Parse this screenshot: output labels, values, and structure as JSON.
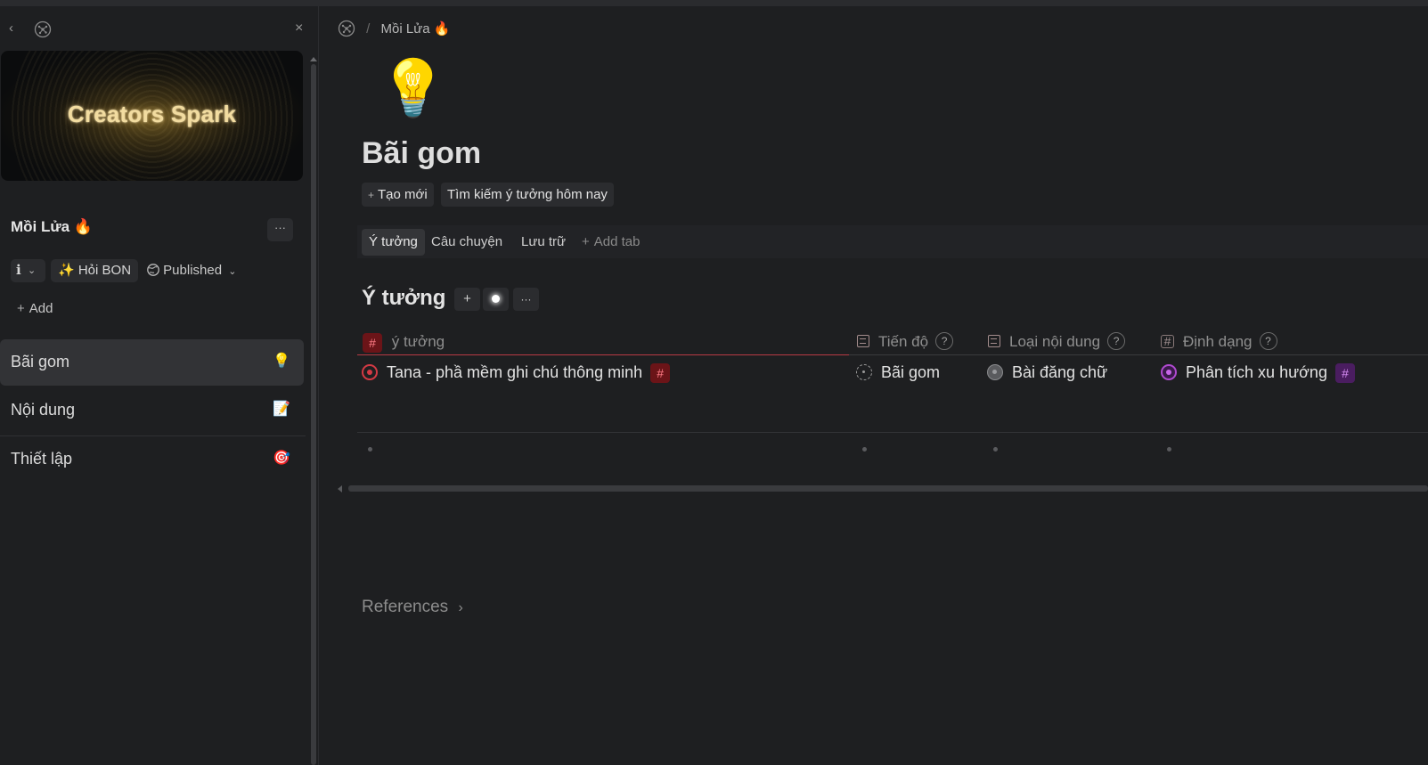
{
  "sidebar": {
    "banner_title": "Creators Spark",
    "workspace_name": "Mồi Lửa 🔥",
    "more_label": "···",
    "info_label": "ℹ",
    "ask_label": "✨ Hỏi BON",
    "publish_label": "Published",
    "add_label": "Add",
    "items": [
      {
        "label": "Bãi gom",
        "emoji": "💡",
        "active": true
      },
      {
        "label": "Nội dung",
        "emoji": "📝",
        "active": false
      },
      {
        "label": "Thiết lập",
        "emoji": "🎯",
        "active": false
      }
    ]
  },
  "breadcrumb": {
    "page": "Mồi Lửa 🔥"
  },
  "page": {
    "emoji": "💡",
    "title": "Bãi gom",
    "actions": {
      "create": "Tạo mới",
      "search": "Tìm kiếm ý tưởng hôm nay"
    },
    "tabs": [
      {
        "label": "Ý tưởng",
        "active": true
      },
      {
        "label": "Câu chuyện",
        "active": false
      },
      {
        "label": "Lưu trữ",
        "active": false
      }
    ],
    "add_tab_label": "Add tab",
    "section": {
      "title": "Ý tưởng",
      "add_btn": "+",
      "more_btn": "···"
    },
    "table": {
      "columns": [
        {
          "label": "ý tưởng",
          "type": "tag"
        },
        {
          "label": "Tiến độ",
          "type": "list"
        },
        {
          "label": "Loại nội dung",
          "type": "list"
        },
        {
          "label": "Định dạng",
          "type": "tag"
        }
      ],
      "help_mark": "?",
      "rows": [
        {
          "idea": "Tana - phầ mềm ghi chú thông minh",
          "progress": "Bãi gom",
          "content_type": "Bài đăng chữ",
          "format": "Phân tích xu hướng"
        }
      ]
    },
    "references_label": "References"
  },
  "colors": {
    "accent_red": "#d33a44",
    "accent_purple": "#b04ad0",
    "background": "#1e1f21"
  }
}
